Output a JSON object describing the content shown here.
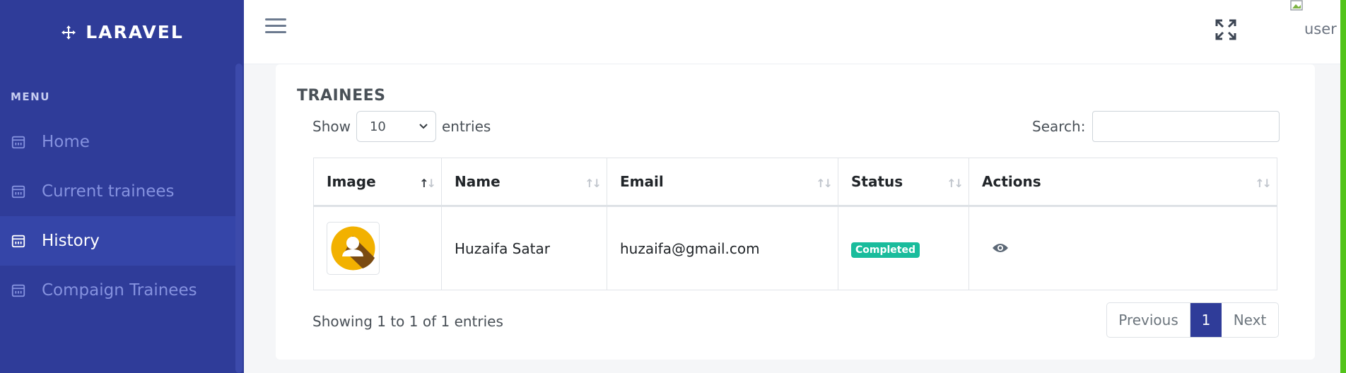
{
  "brand": {
    "name": "LARAVEL",
    "icon": "move-arrows-icon"
  },
  "sidebar": {
    "menu_title": "MENU",
    "items": [
      {
        "label": "Home",
        "icon": "calendar-icon",
        "active": false
      },
      {
        "label": "Current trainees",
        "icon": "calendar-icon",
        "active": false
      },
      {
        "label": "History",
        "icon": "calendar-icon",
        "active": true
      },
      {
        "label": "Compaign Trainees",
        "icon": "calendar-icon",
        "active": false
      }
    ]
  },
  "topbar": {
    "user_label": "user",
    "menu_icon": "hamburger-icon",
    "fullscreen_icon": "fullscreen-icon"
  },
  "card": {
    "title": "TRAINEES",
    "show_label": "Show",
    "entries_value": "10",
    "entries_label": "entries",
    "search_label": "Search:",
    "search_value": ""
  },
  "table": {
    "columns": [
      "Image",
      "Name",
      "Email",
      "Status",
      "Actions"
    ],
    "rows": [
      {
        "name": "Huzaifa Satar",
        "email": "huzaifa@gmail.com",
        "status": "Completed"
      }
    ]
  },
  "footer": {
    "info": "Showing 1 to 1 of 1 entries",
    "previous": "Previous",
    "page": "1",
    "next": "Next"
  },
  "colors": {
    "sidebar": "#2f3c99",
    "badge": "#1abc9c",
    "accent_bar": "#52c41a"
  }
}
